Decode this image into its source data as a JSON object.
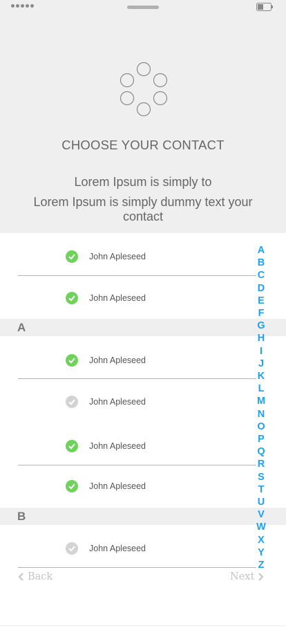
{
  "title": "CHOOSE YOUR CONTACT",
  "subtitle_line1": "Lorem Ipsum is simply to",
  "subtitle_line2": "Lorem Ipsum is simply dummy text your contact",
  "contacts_group_top": [
    {
      "name": "John Apleseed",
      "checked": true
    },
    {
      "name": "John Apleseed",
      "checked": true
    }
  ],
  "sections": [
    {
      "letter": "A",
      "contacts": [
        {
          "name": "John Apleseed",
          "checked": true
        },
        {
          "name": "John Apleseed",
          "checked": false
        },
        {
          "name": "John Apleseed",
          "checked": true
        },
        {
          "name": "John Apleseed",
          "checked": true
        }
      ]
    },
    {
      "letter": "B",
      "contacts": [
        {
          "name": "John Apleseed",
          "checked": false
        }
      ]
    }
  ],
  "alphabet_index": [
    "A",
    "B",
    "C",
    "D",
    "E",
    "F",
    "G",
    "H",
    "I",
    "J",
    "K",
    "L",
    "M",
    "N",
    "O",
    "P",
    "Q",
    "R",
    "S",
    "T",
    "U",
    "V",
    "W",
    "X",
    "Y",
    "Z"
  ],
  "nav": {
    "back_label": "Back",
    "next_label": "Next"
  },
  "colors": {
    "accent": "#1da1f2",
    "checked": "#6ed35a",
    "unchecked": "#d3d3d3",
    "header_bg": "#efefef"
  }
}
